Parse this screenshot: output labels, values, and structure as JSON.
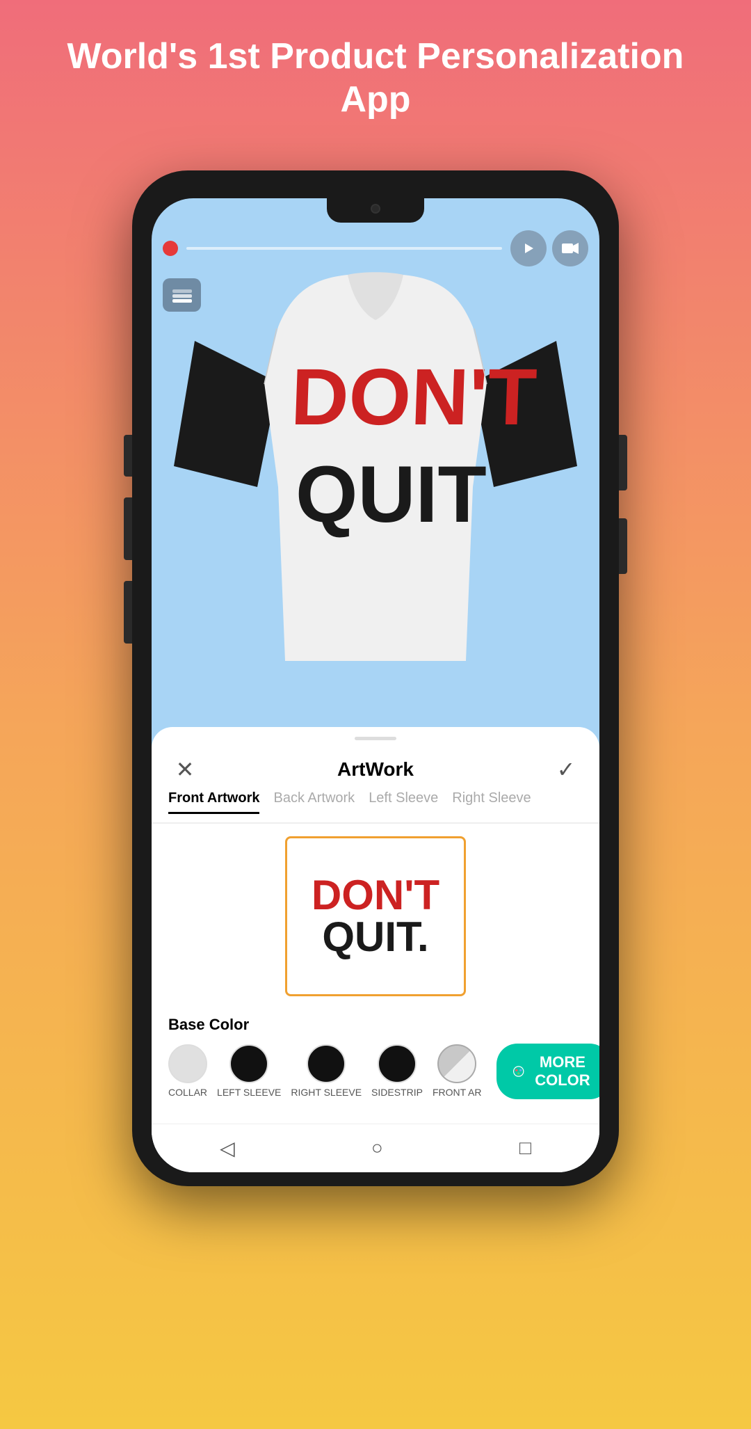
{
  "header": {
    "title": "World's 1st Product Personalization App"
  },
  "phone": {
    "screen": {
      "progress": {
        "dot_color": "#e63939",
        "play_icon": "▶",
        "video_icon": "🎥"
      },
      "tshirt": {
        "body_color": "#f5f5f5",
        "sleeve_color": "#1a1a1a",
        "text_line1_red": "DON'T",
        "text_line2_black": "QUIT"
      },
      "bottom_panel": {
        "title": "ArtWork",
        "close_icon": "✕",
        "check_icon": "✓",
        "tabs": [
          {
            "label": "Front Artwork",
            "active": true
          },
          {
            "label": "Back Artwork",
            "active": false
          },
          {
            "label": "Left Sleeve",
            "active": false
          },
          {
            "label": "Right Sleeve",
            "active": false
          }
        ],
        "artwork_preview": {
          "border_color": "#f0a030",
          "dont_color": "#cc2222",
          "quit_color": "#1a1a1a",
          "period_color": "#1a1a1a"
        },
        "base_color": {
          "label": "Base Color",
          "swatches": [
            {
              "color": "#e0e0e0",
              "label": "COLLAR",
              "selected": false
            },
            {
              "color": "#111111",
              "label": "LEFT SLEEVE",
              "selected": false
            },
            {
              "color": "#111111",
              "label": "RIGHT SLEEVE",
              "selected": false
            },
            {
              "color": "#111111",
              "label": "SIDESTRIP",
              "selected": false
            },
            {
              "color": "#c8c8c8",
              "label": "FRONT AR",
              "selected": true
            }
          ],
          "more_color_btn": "MORE COLOR",
          "more_color_bg": "#00c9a7"
        }
      }
    }
  },
  "nav": {
    "back_icon": "◁",
    "home_icon": "○",
    "recents_icon": "□"
  }
}
